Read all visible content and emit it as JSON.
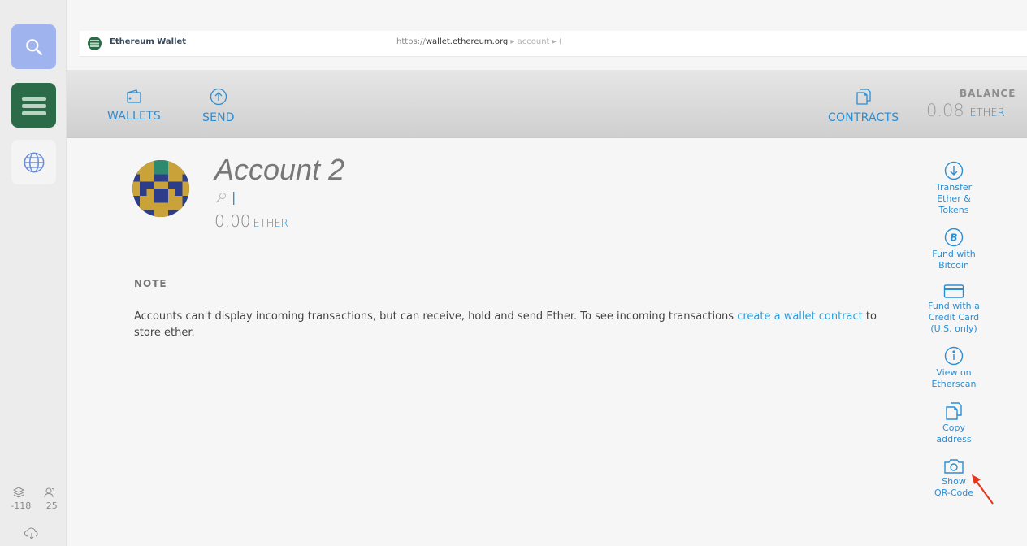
{
  "sidebar": {
    "stats": {
      "left_value": "-118",
      "right_value": "25"
    }
  },
  "browser": {
    "tab_title": "Ethereum Wallet",
    "url_prefix": "https://",
    "url_host": "wallet.ethereum.org",
    "url_path": " ▸ account ▸ ("
  },
  "nav": {
    "wallets_label": "WALLETS",
    "send_label": "SEND",
    "contracts_label": "CONTRACTS",
    "balance_label": "BALANCE",
    "balance_amount": "0.08",
    "balance_unit": "ETHER"
  },
  "account": {
    "name": "Account 2",
    "balance_amount": "0.00",
    "balance_unit": "ETHER"
  },
  "note": {
    "title": "NOTE",
    "text_before": "Accounts can't display incoming transactions, but can receive, hold and send Ether. To see incoming transactions ",
    "link": "create a wallet contract",
    "text_after": " to store ether."
  },
  "actions": {
    "transfer": "Transfer Ether & Tokens",
    "fund_bitcoin": "Fund with Bitcoin",
    "fund_card": "Fund with a Credit Card (U.S. only)",
    "etherscan": "View on Etherscan",
    "copy": "Copy address",
    "qr": "Show QR-Code"
  },
  "colors": {
    "accent": "#2b8ed3",
    "sidebar_search": "#9fb4ef",
    "sidebar_wallet": "#2c6b48",
    "annotation_arrow": "#e8341c"
  }
}
